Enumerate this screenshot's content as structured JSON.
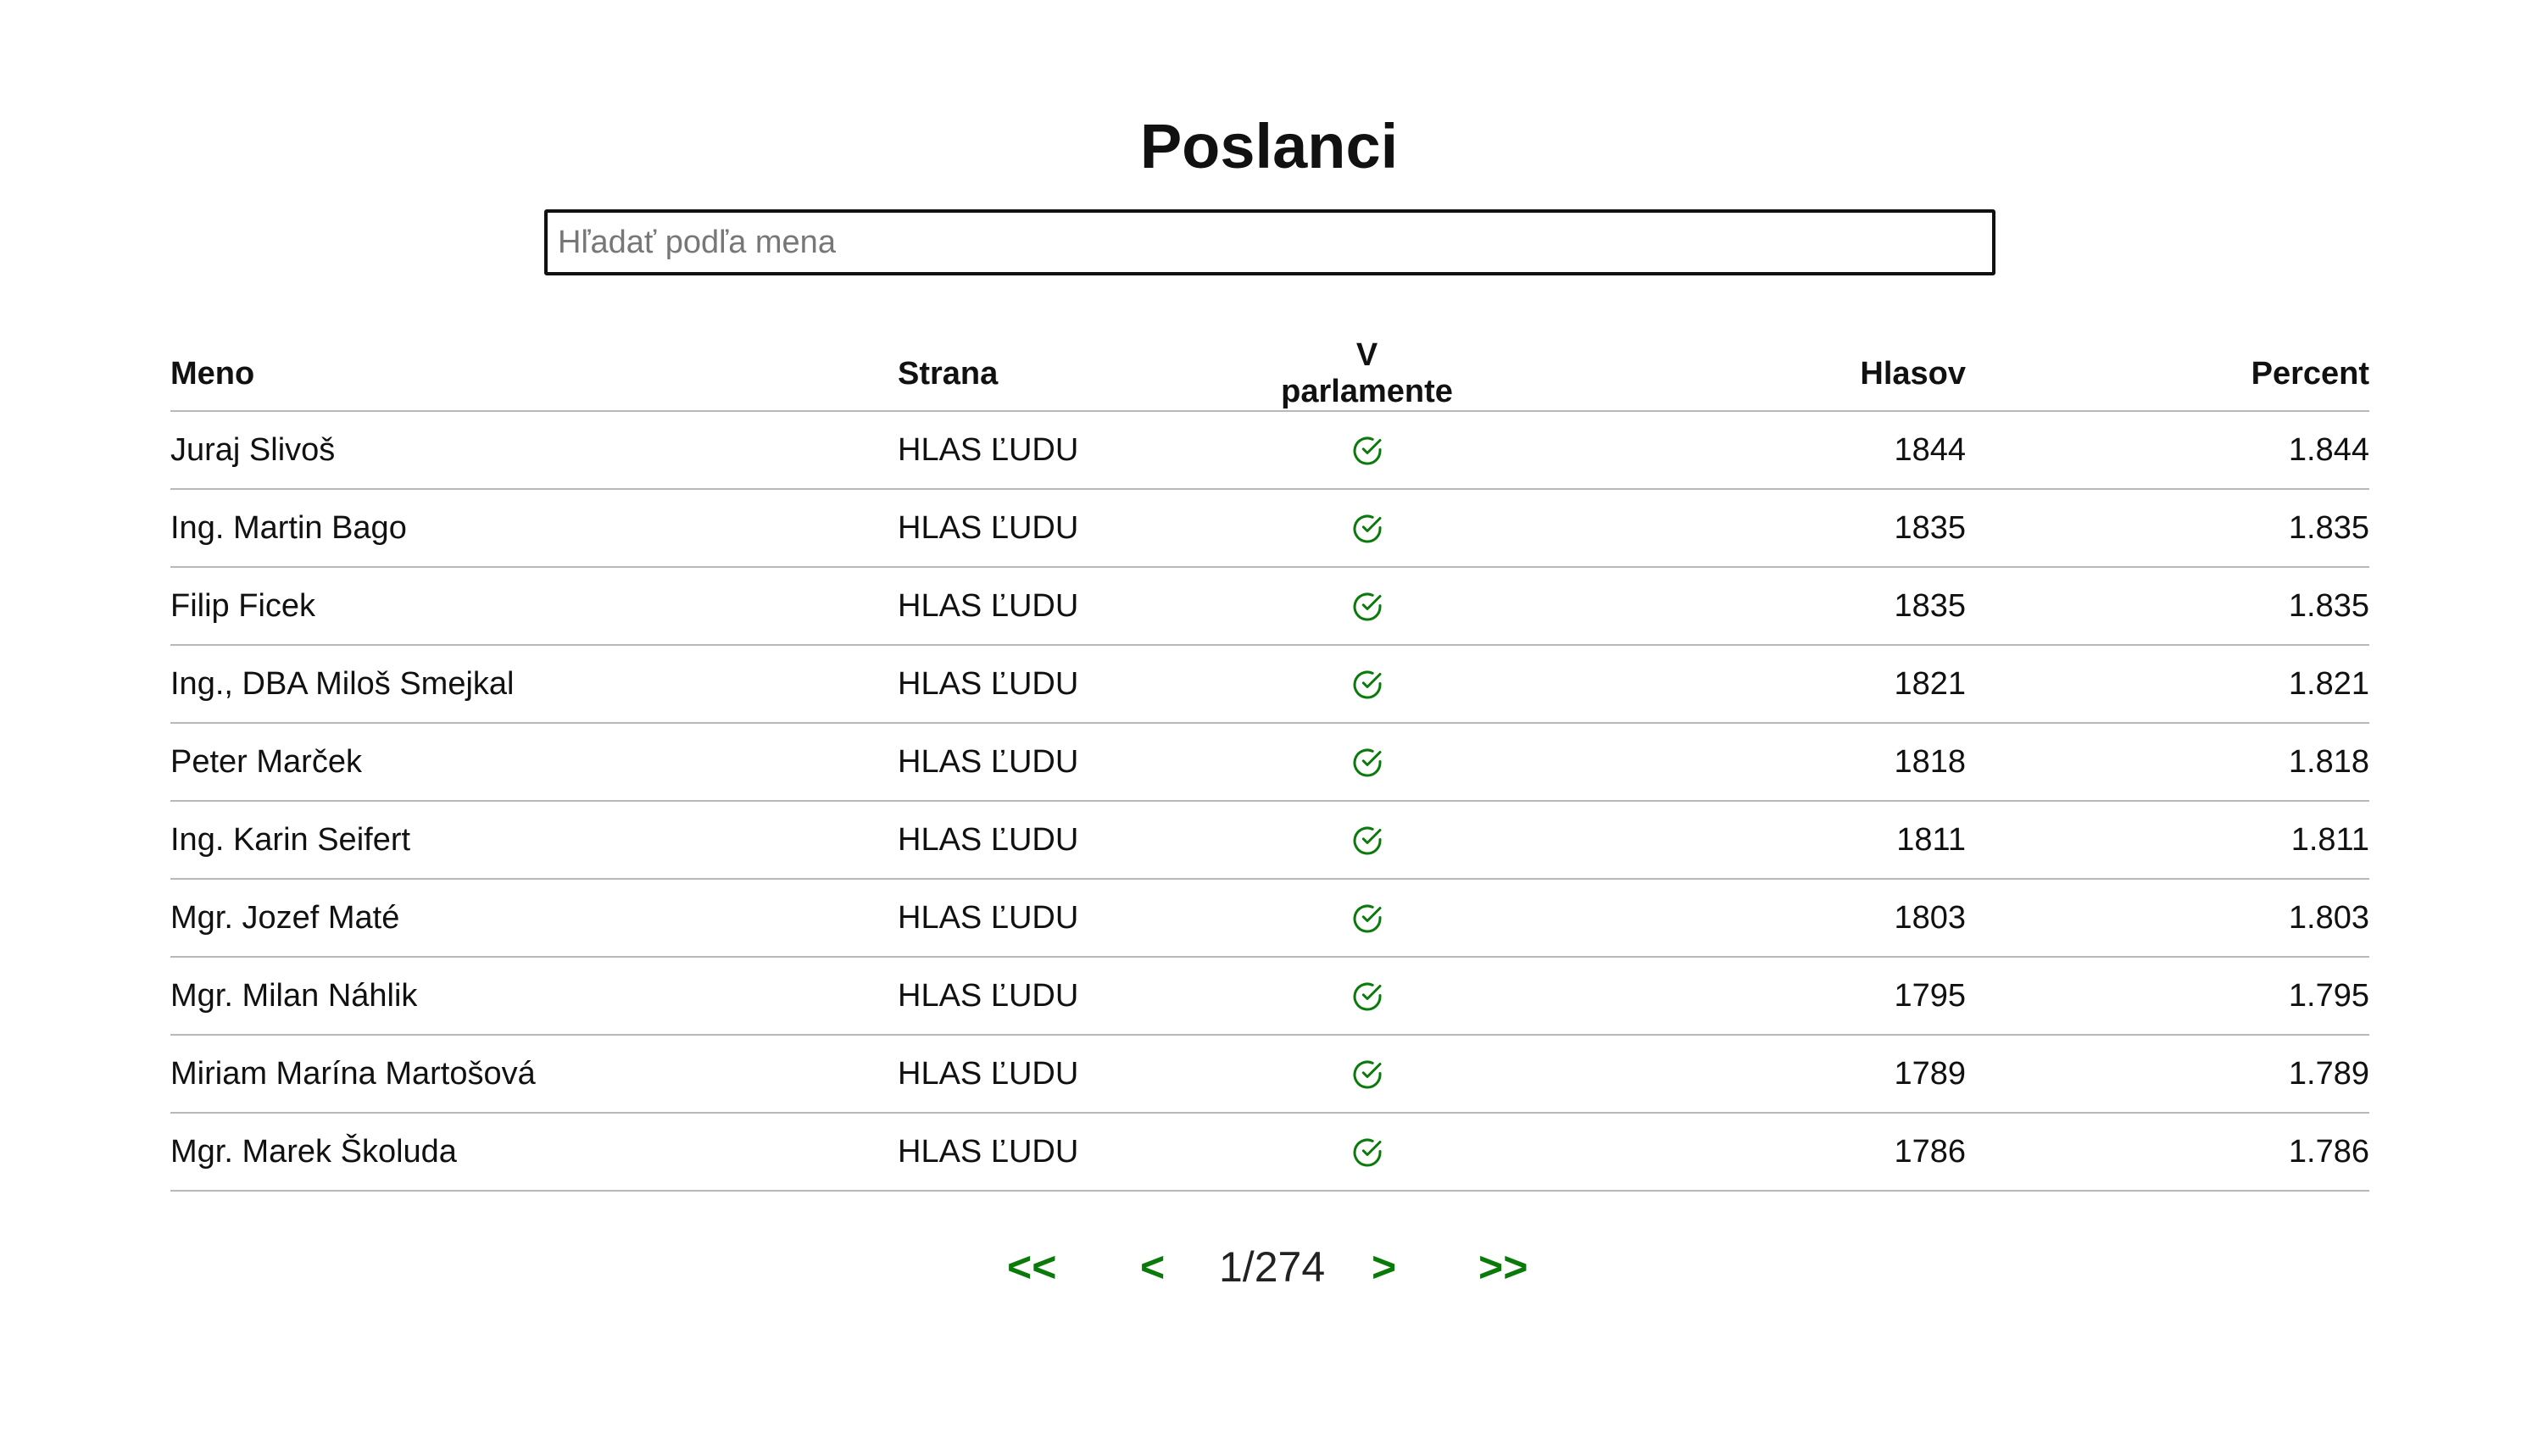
{
  "page": {
    "title": "Poslanci"
  },
  "search": {
    "placeholder": "Hľadať podľa mena",
    "value": ""
  },
  "table": {
    "headers": {
      "name": "Meno",
      "party": "Strana",
      "in_parliament": "V parlamente",
      "votes": "Hlasov",
      "percent": "Percent"
    },
    "rows": [
      {
        "name": "Juraj Slivoš",
        "party": "HLAS ĽUDU",
        "in_parliament": true,
        "votes": "1844",
        "percent": "1.844"
      },
      {
        "name": "Ing. Martin Bago",
        "party": "HLAS ĽUDU",
        "in_parliament": true,
        "votes": "1835",
        "percent": "1.835"
      },
      {
        "name": "Filip Ficek",
        "party": "HLAS ĽUDU",
        "in_parliament": true,
        "votes": "1835",
        "percent": "1.835"
      },
      {
        "name": "Ing., DBA Miloš Smejkal",
        "party": "HLAS ĽUDU",
        "in_parliament": true,
        "votes": "1821",
        "percent": "1.821"
      },
      {
        "name": "Peter Marček",
        "party": "HLAS ĽUDU",
        "in_parliament": true,
        "votes": "1818",
        "percent": "1.818"
      },
      {
        "name": "Ing. Karin Seifert",
        "party": "HLAS ĽUDU",
        "in_parliament": true,
        "votes": "1811",
        "percent": "1.811"
      },
      {
        "name": "Mgr. Jozef Maté",
        "party": "HLAS ĽUDU",
        "in_parliament": true,
        "votes": "1803",
        "percent": "1.803"
      },
      {
        "name": "Mgr. Milan Náhlik",
        "party": "HLAS ĽUDU",
        "in_parliament": true,
        "votes": "1795",
        "percent": "1.795"
      },
      {
        "name": "Miriam Marína Martošová",
        "party": "HLAS ĽUDU",
        "in_parliament": true,
        "votes": "1789",
        "percent": "1.789"
      },
      {
        "name": "Mgr. Marek Školuda",
        "party": "HLAS ĽUDU",
        "in_parliament": true,
        "votes": "1786",
        "percent": "1.786"
      }
    ]
  },
  "pagination": {
    "first_label": "<<",
    "prev_label": "<",
    "page_info": "1/274",
    "next_label": ">",
    "last_label": ">>"
  },
  "icons": {
    "in_parliament": "check-circle-icon"
  },
  "colors": {
    "accent": "#0a7a0a",
    "row_border": "#b8b8b8",
    "text": "#111111"
  }
}
